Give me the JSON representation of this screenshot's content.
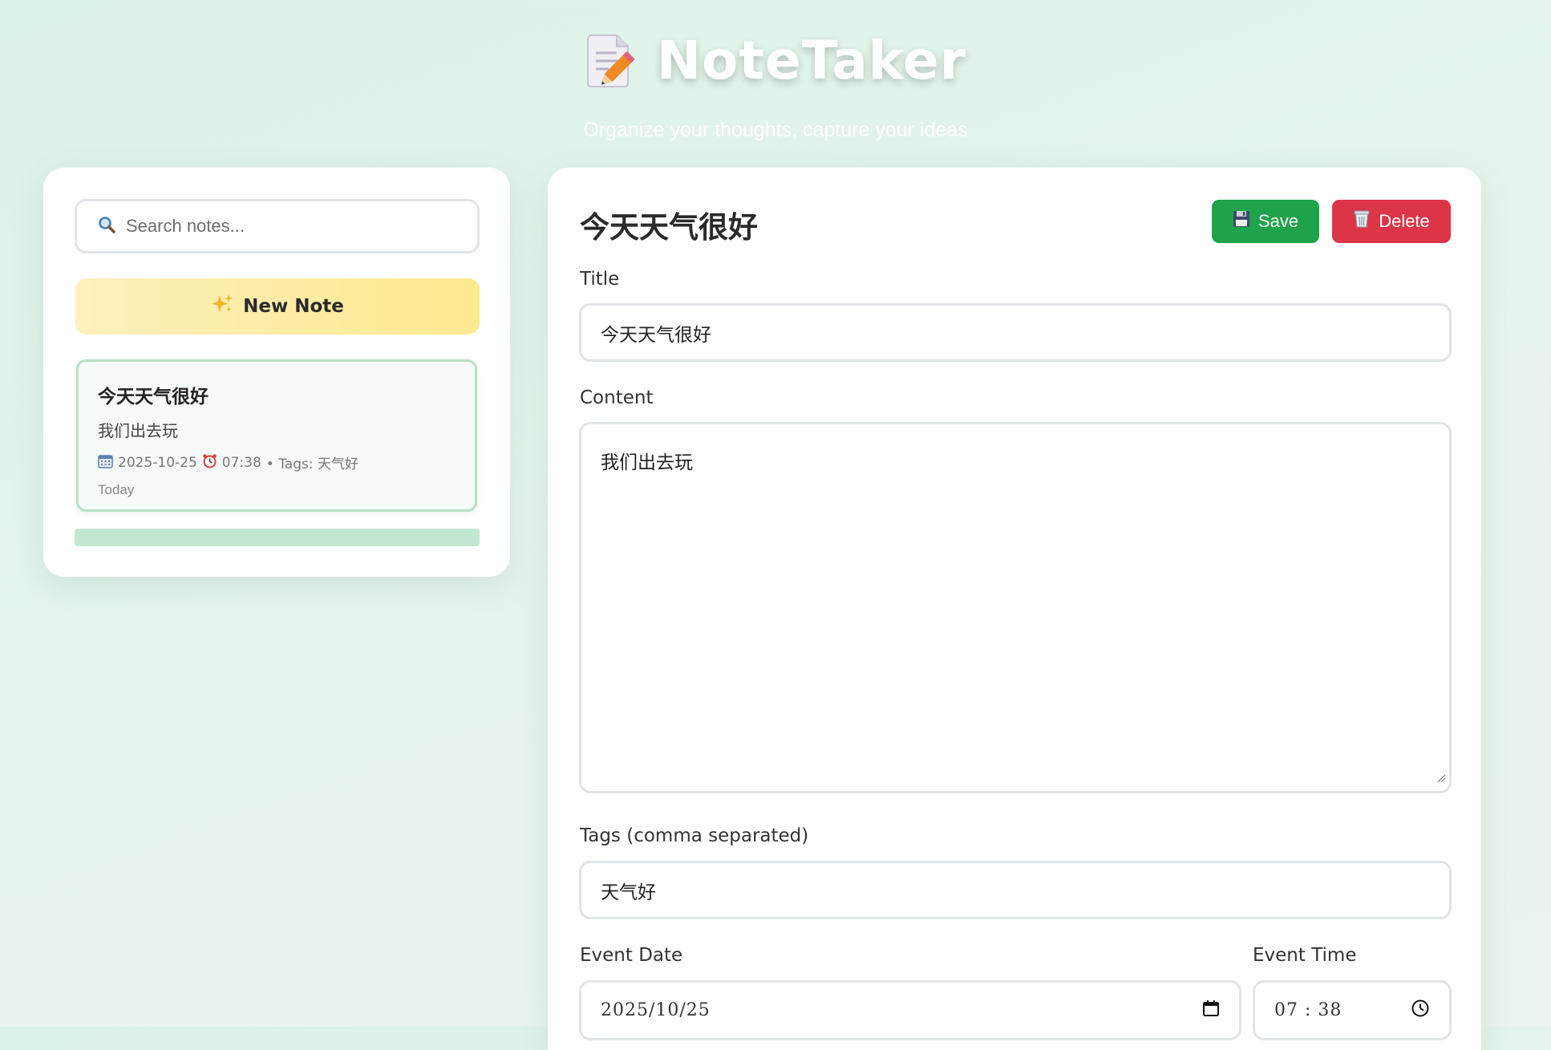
{
  "header": {
    "app_title": "NoteTaker",
    "subtitle": "Organize your thoughts, capture your ideas",
    "logo_icon": "memo-pencil-icon"
  },
  "sidebar": {
    "search": {
      "placeholder": "Search notes...",
      "value": "",
      "icon": "search-icon"
    },
    "new_note": {
      "icon": "sparkles-icon",
      "label": "New Note"
    },
    "notes": [
      {
        "title": "今天天气很好",
        "preview": "我们出去玩",
        "date": "2025-10-25",
        "time": "07:38",
        "tags_text": "• Tags: 天气好",
        "relative": "Today"
      }
    ]
  },
  "editor": {
    "heading": "今天天气很好",
    "save_label": "Save",
    "save_icon": "floppy-disk-icon",
    "delete_label": "Delete",
    "delete_icon": "wastebasket-icon",
    "title_label": "Title",
    "title_value": "今天天气很好",
    "content_label": "Content",
    "content_value": "我们出去玩",
    "tags_label": "Tags (comma separated)",
    "tags_value": "天气好",
    "event_date_label": "Event Date",
    "event_date_value": "2025/10/25",
    "event_time_label": "Event Time",
    "event_time_value": "07 : 38"
  },
  "colors": {
    "background": "#dff3e8",
    "save_button": "#1ea34b",
    "delete_button": "#dc3548",
    "new_note_button": "#fde98f",
    "active_note_border": "#b6e2c7"
  }
}
